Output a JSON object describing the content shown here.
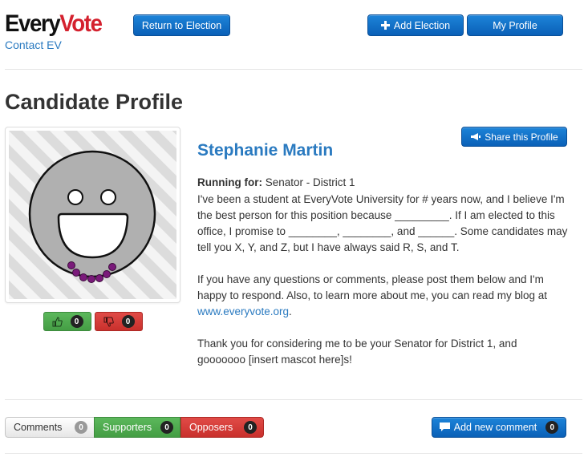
{
  "header": {
    "logo_every": "Every",
    "logo_vote": "Vote",
    "contact_link": "Contact EV",
    "return_button": "Return to Election",
    "add_election_button": "Add Election",
    "my_profile_button": "My Profile"
  },
  "page": {
    "title": "Candidate Profile"
  },
  "candidate": {
    "name": "Stephanie Martin",
    "running_label": "Running for:",
    "running_value": "Senator - District 1",
    "share_button": "Share this Profile",
    "likes": "0",
    "dislikes": "0",
    "bio_p1": "I've been a student at EveryVote University for # years now, and I believe I'm the best person for this position because _________. If I am elected to this office, I promise to ________, ________, and ______. Some candidates may tell you X, Y, and Z, but I have always said R, S, and T.",
    "bio_p2_before": "If you have any questions or comments, please post them below and I'm happy to respond. Also, to learn more about me, you can read my blog at ",
    "bio_p2_link": "www.everyvote.org",
    "bio_p2_after": ".",
    "bio_p3": "Thank you for considering me to be your Senator for District 1, and gooooooo [insert mascot here]s!"
  },
  "tabs": {
    "comments_label": "Comments",
    "comments_count": "0",
    "supporters_label": "Supporters",
    "supporters_count": "0",
    "opposers_label": "Opposers",
    "opposers_count": "0"
  },
  "actions": {
    "add_comment_button": "Add new comment",
    "add_comment_count": "0"
  },
  "icons": {
    "add_election": "plus-icon",
    "share": "megaphone-icon",
    "comment": "comment-icon",
    "like": "thumbs-up-icon",
    "dislike": "thumbs-down-icon"
  },
  "colors": {
    "brand_red": "#d4212e",
    "link_blue": "#2a7ac0",
    "button_blue": "#0a60b7",
    "success_green": "#449d44",
    "danger_red": "#c9302c"
  }
}
